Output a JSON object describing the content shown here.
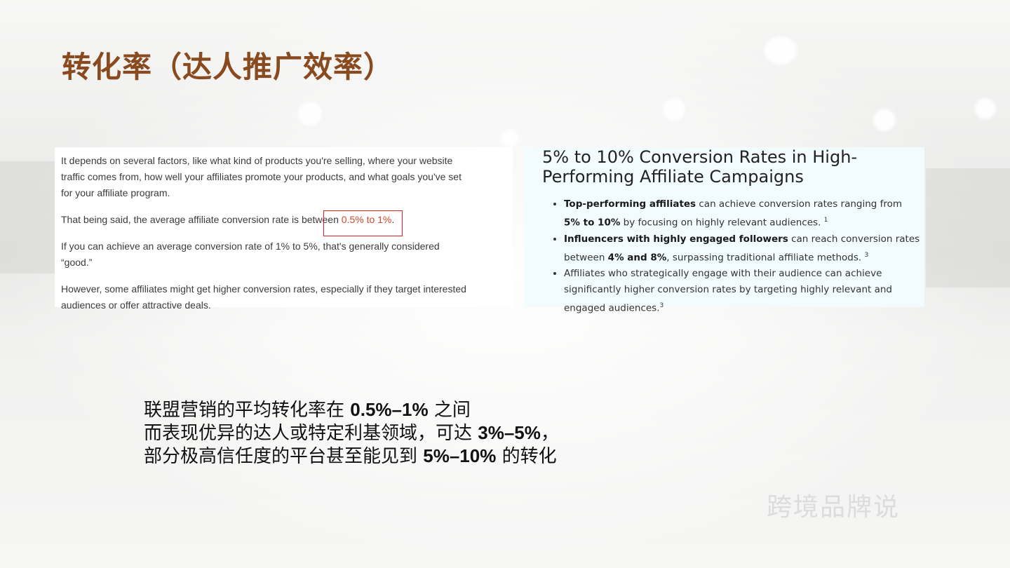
{
  "slide": {
    "title": "转化率（达人推广效率）",
    "watermark": "跨境品牌说"
  },
  "left_card": {
    "paragraphs": [
      "It depends on several factors, like what kind of products you're selling, where your website traffic comes from, how well your affiliates promote your products, and what goals you've set for your affiliate program.",
      "If you can achieve an average conversion rate of 1% to 5%, that's generally considered “good.”",
      "However, some affiliates might get higher conversion rates, especially if they target interested audiences or offer attractive deals."
    ],
    "highlight_line": {
      "before": "That being said, the average affiliate conversion rate is between ",
      "highlight": "0.5% to 1%",
      "after": "."
    }
  },
  "right_card": {
    "heading_line1": "5% to 10% Conversion Rates in High-",
    "heading_line2": "Performing Affiliate Campaigns",
    "bullets": [
      {
        "bold1": "Top-performing affiliates",
        "text1": " can achieve conversion rates ranging from",
        "bold2": "5% to 10%",
        "text2": " by focusing on highly relevant audiences.",
        "sup": "1"
      },
      {
        "bold1": "Influencers with highly engaged followers",
        "text1": " can reach conversion rates",
        "text2a": "between ",
        "bold2": "4% and 8%",
        "text2": ", surpassing traditional affiliate methods.",
        "sup": "3"
      },
      {
        "line1": "Affiliates who strategically engage with their audience can achieve",
        "line2": "significantly higher conversion rates by targeting highly relevant and",
        "line3": "engaged audiences.",
        "sup": "3"
      }
    ]
  },
  "summary": {
    "line1_text": "联盟营销的平均转化率在 ",
    "line1_bold": "0.5%–1%",
    "line1_end": " 之间",
    "line2_text": "而表现优异的达人或特定利基领域，可达 ",
    "line2_bold": "3%–5%",
    "line2_end": "，",
    "line3_text": "部分极高信任度的平台甚至能见到 ",
    "line3_bold": "5%–10%",
    "line3_end": " 的转化"
  }
}
